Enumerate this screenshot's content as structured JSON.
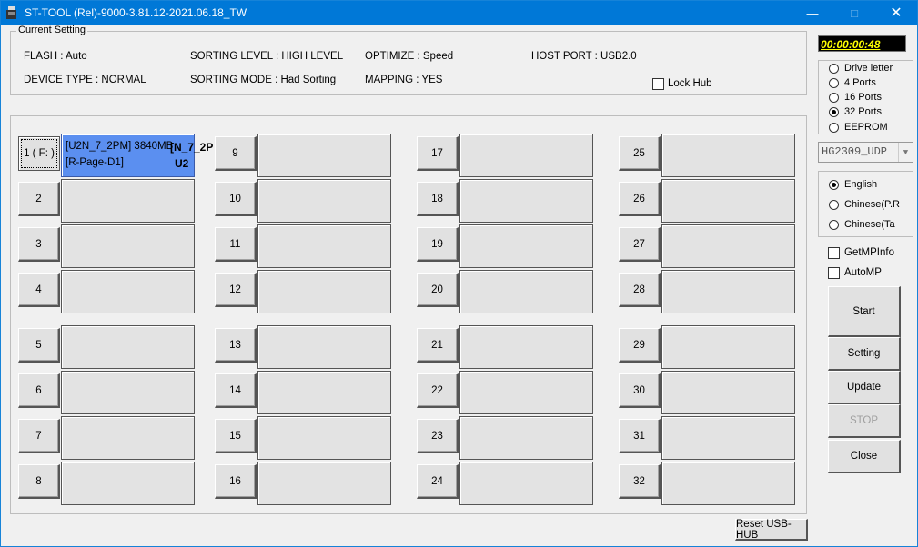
{
  "window": {
    "title": "ST-TOOL (Rel)-9000-3.81.12-2021.06.18_TW"
  },
  "current_setting": {
    "label": "Current Setting",
    "flash": "FLASH : Auto",
    "device_type": "DEVICE TYPE : NORMAL",
    "sorting_level": "SORTING LEVEL : HIGH LEVEL",
    "sorting_mode": "SORTING MODE : Had Sorting",
    "optimize": "OPTIMIZE : Speed",
    "mapping": "MAPPING : YES",
    "host_port": "HOST PORT : USB2.0",
    "lock_hub": "Lock Hub"
  },
  "timer": "00:00:00:48",
  "port_mode": {
    "options": [
      "Drive letter",
      "4 Ports",
      "16 Ports",
      "32 Ports",
      "EEPROM"
    ],
    "selected": "32 Ports"
  },
  "device_select": "HG2309_UDP",
  "language": {
    "options": [
      "English",
      "Chinese(P.R",
      "Chinese(Ta"
    ],
    "selected": "English"
  },
  "checks": {
    "get_mp_info": "GetMPInfo",
    "auto_mp": "AutoMP"
  },
  "actions": {
    "start": "Start",
    "setting": "Setting",
    "update": "Update",
    "stop": "STOP",
    "close": "Close"
  },
  "reset_hub": "Reset USB-HUB",
  "ports": [
    "1 ( F: )",
    "2",
    "3",
    "4",
    "5",
    "6",
    "7",
    "8",
    "9",
    "10",
    "11",
    "12",
    "13",
    "14",
    "15",
    "16",
    "17",
    "18",
    "19",
    "20",
    "21",
    "22",
    "23",
    "24",
    "25",
    "26",
    "27",
    "28",
    "29",
    "30",
    "31",
    "32"
  ],
  "port1_info": {
    "line1": "[U2N_7_2PM] 3840MB",
    "line2": "[R-Page-D1]",
    "tag": "[N_7_2P",
    "usb": "U2"
  }
}
